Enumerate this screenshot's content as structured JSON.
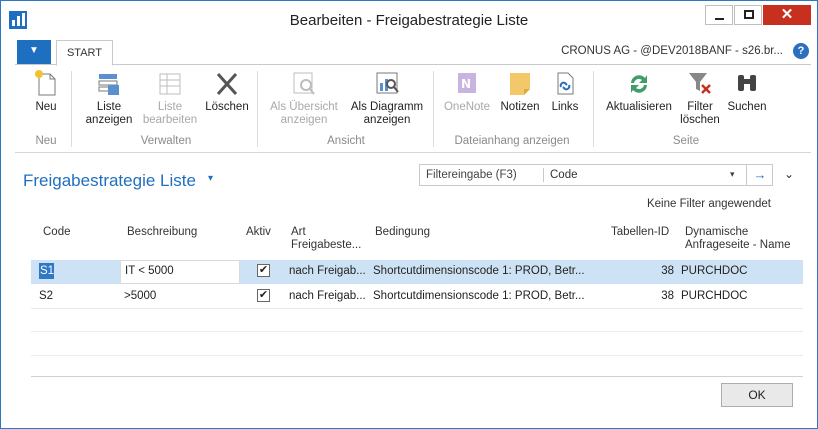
{
  "window": {
    "title": "Bearbeiten - Freigabestrategie Liste",
    "minimize_glyph": "—",
    "close_glyph": "✕"
  },
  "ribbon_tabs": {
    "file_glyph": "▼",
    "start_label": "START",
    "company": "CRONUS AG - @DEV2018BANF - s26.br...",
    "help_glyph": "?"
  },
  "ribbon": {
    "neu": "Neu",
    "liste_anzeigen": [
      "Liste",
      "anzeigen"
    ],
    "liste_bearbeiten": [
      "Liste",
      "bearbeiten"
    ],
    "loeschen": "Löschen",
    "als_uebersicht": [
      "Als Übersicht",
      "anzeigen"
    ],
    "als_diagramm": [
      "Als Diagramm",
      "anzeigen"
    ],
    "onenote": "OneNote",
    "notizen": "Notizen",
    "links": "Links",
    "aktualisieren": "Aktualisieren",
    "filter_loeschen": [
      "Filter",
      "löschen"
    ],
    "suchen": "Suchen",
    "groups": {
      "neu": "Neu",
      "verwalten": "Verwalten",
      "ansicht": "Ansicht",
      "dateianhang": "Dateianhang anzeigen",
      "seite": "Seite"
    }
  },
  "page": {
    "title": "Freigabestrategie Liste",
    "title_caret": "▾",
    "filter_placeholder": "Filtereingabe (F3)",
    "filter_field": "Code",
    "filter_dropdown_glyph": "▾",
    "filter_go_glyph": "→",
    "collapse_glyph": "⌄",
    "no_filter": "Keine Filter angewendet"
  },
  "grid": {
    "headers": {
      "code": "Code",
      "beschreibung": "Beschreibung",
      "aktiv": "Aktiv",
      "art": [
        "Art",
        "Freigabeste..."
      ],
      "bedingung": "Bedingung",
      "tabellen_id": "Tabellen-ID",
      "dyn": [
        "Dynamische",
        "Anfrageseite - Name"
      ]
    },
    "rows": [
      {
        "code": "S1",
        "beschreibung": "IT < 5000",
        "aktiv": true,
        "aktiv_glyph": "✔",
        "art": "nach Freigab...",
        "bedingung": "Shortcutdimensionscode 1: PROD, Betr...",
        "tabellen_id": "38",
        "dyn": "PURCHDOC"
      },
      {
        "code": "S2",
        "beschreibung": ">5000",
        "aktiv": true,
        "aktiv_glyph": "✔",
        "art": "nach Freigab...",
        "bedingung": "Shortcutdimensionscode 1: PROD, Betr...",
        "tabellen_id": "38",
        "dyn": "PURCHDOC"
      }
    ]
  },
  "footer": {
    "ok": "OK"
  },
  "colors": {
    "accent": "#1f6fc0",
    "selection": "#cde3f5",
    "close": "#c7301f"
  }
}
